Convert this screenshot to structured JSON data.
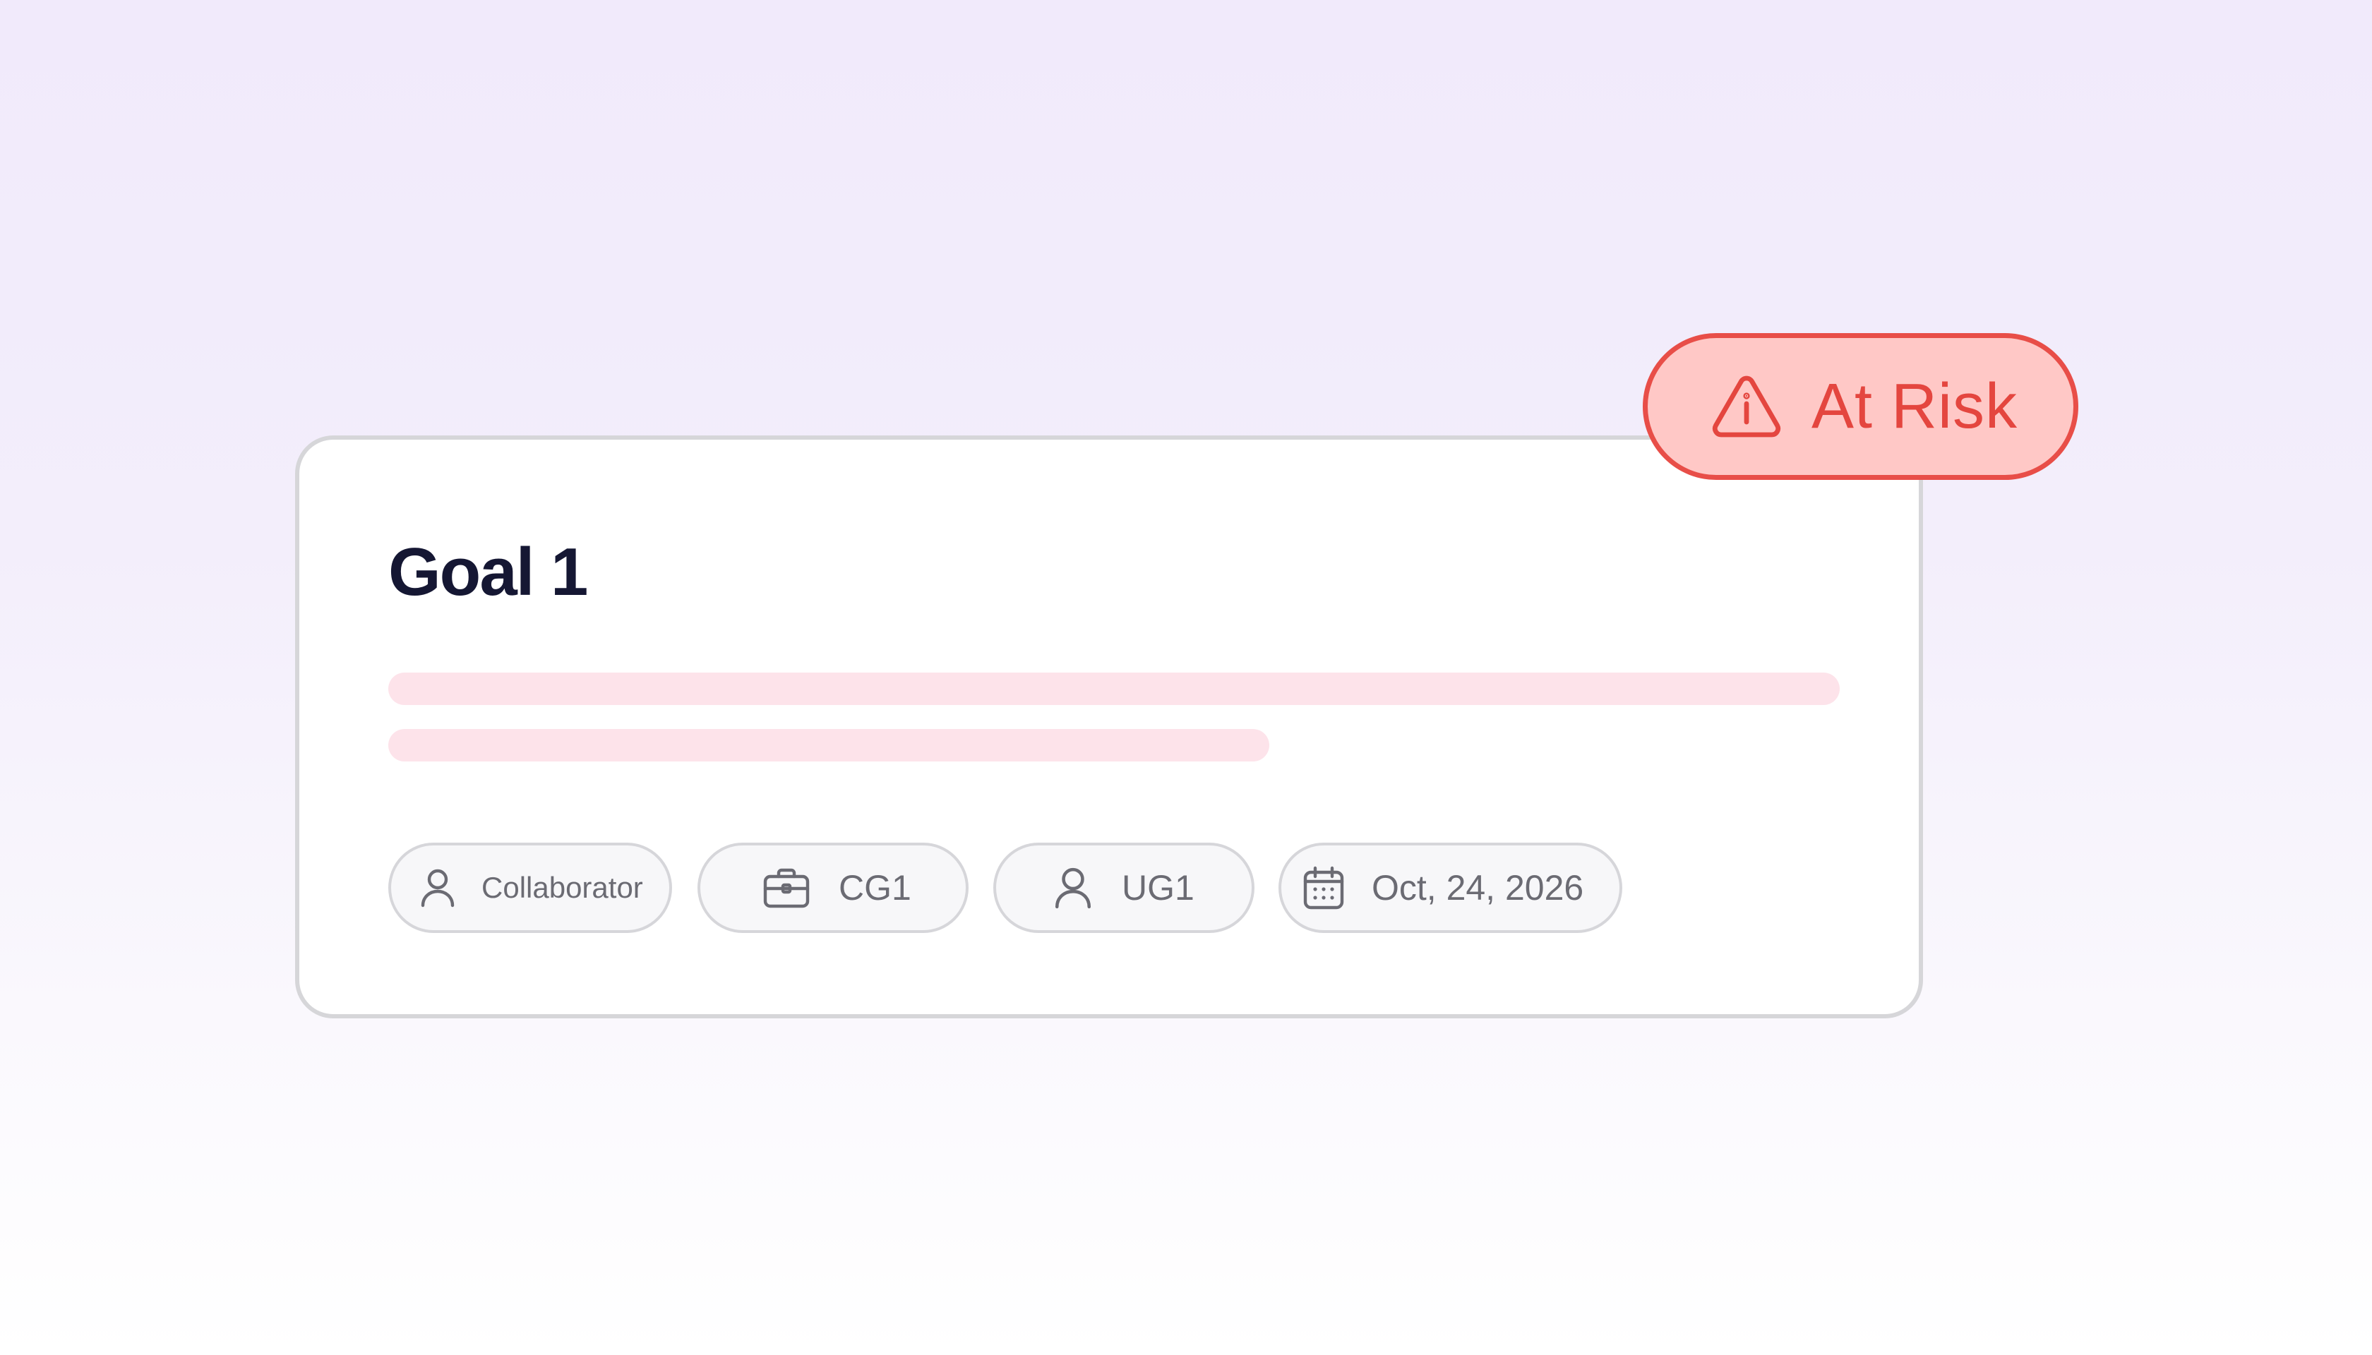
{
  "card": {
    "title": "Goal 1",
    "chips": {
      "collaborator": {
        "label": "Collaborator",
        "icon": "user-icon"
      },
      "company_goal": {
        "label": "CG1",
        "icon": "briefcase-icon"
      },
      "user_goal": {
        "label": "UG1",
        "icon": "user-icon"
      },
      "due_date": {
        "label": "Oct, 24, 2026",
        "icon": "calendar-icon"
      }
    }
  },
  "status": {
    "label": "At Risk",
    "icon": "warning-triangle-icon",
    "color": "#E4463F",
    "background": "#FFC8C6"
  },
  "colors": {
    "background_top": "#F1EAFB",
    "background_bottom": "#FFFFFF",
    "card_border": "#D6D6D9",
    "title": "#151733",
    "placeholder": "#FDE3EA",
    "chip_text": "#6B6B73"
  }
}
